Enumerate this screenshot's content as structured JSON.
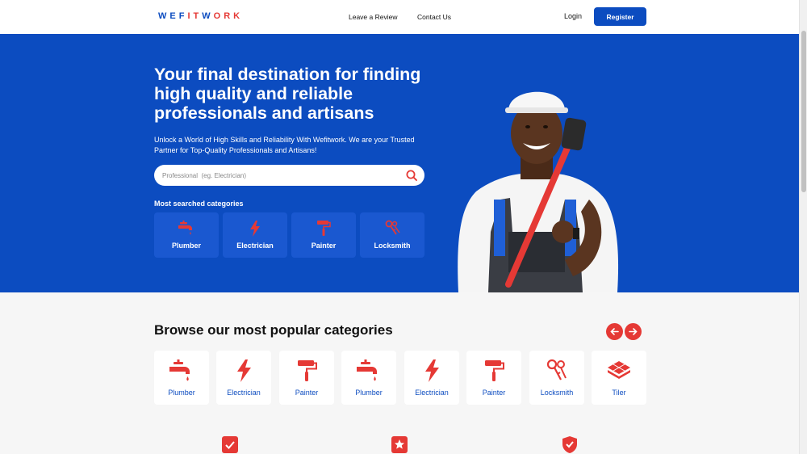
{
  "header": {
    "logo_parts": [
      "WEF",
      "IT",
      "W",
      "O",
      "RK"
    ],
    "nav": [
      {
        "label": "Leave a Review"
      },
      {
        "label": "Contact Us"
      }
    ],
    "login_label": "Login",
    "register_label": "Register"
  },
  "hero": {
    "title": "Your final destination for finding high quality and reliable professionals and artisans",
    "subtitle": "Unlock a World of High Skills and Reliability With Wefitwork. We are your Trusted Partner for Top-Quality Professionals and Artisans!",
    "search": {
      "placeholder": "Professional  (eg. Electrician)"
    },
    "most_searched_label": "Most searched categories",
    "categories": [
      {
        "label": "Plumber",
        "icon": "faucet-icon"
      },
      {
        "label": "Electrician",
        "icon": "lightning-icon"
      },
      {
        "label": "Painter",
        "icon": "paint-roller-icon"
      },
      {
        "label": "Locksmith",
        "icon": "keys-icon"
      }
    ]
  },
  "browse": {
    "title": "Browse our most popular categories",
    "categories": [
      {
        "label": "Plumber",
        "icon": "faucet-icon"
      },
      {
        "label": "Electrician",
        "icon": "lightning-icon"
      },
      {
        "label": "Painter",
        "icon": "paint-roller-icon"
      },
      {
        "label": "Plumber",
        "icon": "faucet-icon"
      },
      {
        "label": "Electrician",
        "icon": "lightning-icon"
      },
      {
        "label": "Painter",
        "icon": "paint-roller-icon"
      },
      {
        "label": "Locksmith",
        "icon": "keys-icon"
      },
      {
        "label": "Tiler",
        "icon": "tiles-icon"
      }
    ]
  },
  "colors": {
    "brand_blue": "#0c4cc0",
    "accent_red": "#e53935",
    "background": "#f6f6f6"
  }
}
